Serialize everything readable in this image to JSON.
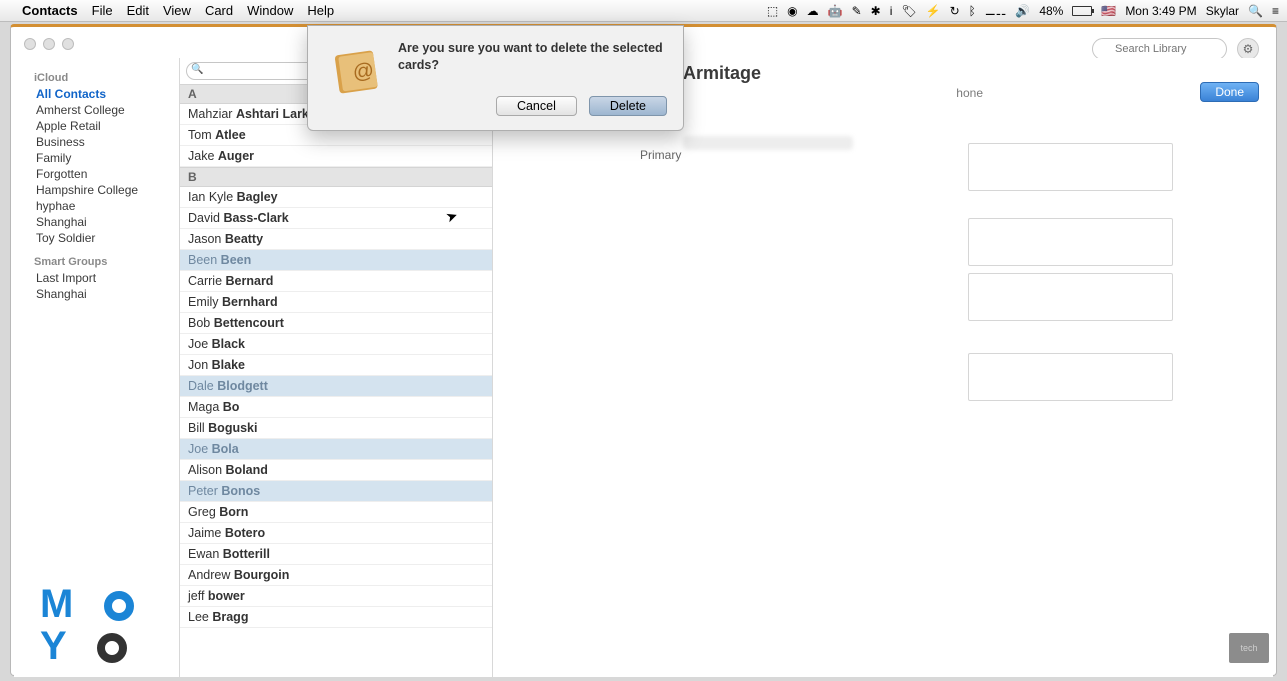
{
  "menubar": {
    "app": "Contacts",
    "items": [
      "File",
      "Edit",
      "View",
      "Card",
      "Window",
      "Help"
    ],
    "battery": "48%",
    "clock": "Mon 3:49 PM",
    "user": "Skylar"
  },
  "toolbar": {
    "search_placeholder": "Search Library"
  },
  "sidebar": {
    "section1_header": "iCloud",
    "groups": [
      "All Contacts",
      "Amherst College",
      "Apple Retail",
      "Business",
      "Family",
      "Forgotten",
      "Hampshire College",
      "hyphae",
      "Shanghai",
      "Toy Soldier"
    ],
    "section2_header": "Smart Groups",
    "smart": [
      "Last Import",
      "Shanghai"
    ]
  },
  "list": {
    "sections": [
      {
        "letter": "A",
        "rows": [
          {
            "first": "Mahziar",
            "last": "Ashtari Lark",
            "sel": false
          },
          {
            "first": "Tom",
            "last": "Atlee",
            "sel": false
          },
          {
            "first": "Jake",
            "last": "Auger",
            "sel": false
          }
        ]
      },
      {
        "letter": "B",
        "rows": [
          {
            "first": "Ian Kyle",
            "last": "Bagley",
            "sel": false
          },
          {
            "first": "David",
            "last": "Bass-Clark",
            "sel": false
          },
          {
            "first": "Jason",
            "last": "Beatty",
            "sel": false
          },
          {
            "first": "Been",
            "last": "Been",
            "sel": true
          },
          {
            "first": "Carrie",
            "last": "Bernard",
            "sel": false
          },
          {
            "first": "Emily",
            "last": "Bernhard",
            "sel": false
          },
          {
            "first": "Bob",
            "last": "Bettencourt",
            "sel": false
          },
          {
            "first": "Joe",
            "last": "Black",
            "sel": false
          },
          {
            "first": "Jon",
            "last": "Blake",
            "sel": false
          },
          {
            "first": "Dale",
            "last": "Blodgett",
            "sel": true
          },
          {
            "first": "Maga",
            "last": "Bo",
            "sel": false
          },
          {
            "first": "Bill",
            "last": "Boguski",
            "sel": false
          },
          {
            "first": "Joe",
            "last": "Bola",
            "sel": true
          },
          {
            "first": "Alison",
            "last": "Boland",
            "sel": false
          },
          {
            "first": "Peter",
            "last": "Bonos",
            "sel": true
          },
          {
            "first": "Greg",
            "last": "Born",
            "sel": false
          },
          {
            "first": "Jaime",
            "last": "Botero",
            "sel": false
          },
          {
            "first": "Ewan",
            "last": "Botterill",
            "sel": false
          },
          {
            "first": "Andrew",
            "last": "Bourgoin",
            "sel": false
          },
          {
            "first": "jeff",
            "last": "bower",
            "sel": false
          },
          {
            "first": "Lee",
            "last": "Bragg",
            "sel": false
          }
        ]
      }
    ]
  },
  "detail": {
    "name": "Armitage",
    "phone_label": "hone",
    "primary_label": "Primary",
    "done": "Done"
  },
  "dialog": {
    "message": "Are you sure you want to delete the selected cards?",
    "cancel": "Cancel",
    "delete": "Delete"
  },
  "watermark": {
    "line1": "M",
    "line2": "Y",
    "badge": "tech"
  }
}
